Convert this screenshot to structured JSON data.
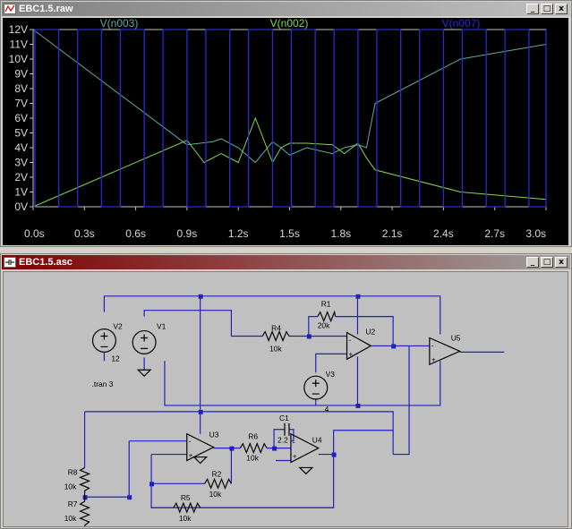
{
  "waveform_window": {
    "title": "EBC1.5.raw",
    "buttons": {
      "minimize": "_",
      "maximize": "□",
      "close": "x"
    }
  },
  "schematic_window": {
    "title": "EBC1.5.asc",
    "buttons": {
      "minimize": "_",
      "maximize": "□",
      "close": "x"
    }
  },
  "chart_data": {
    "type": "line",
    "ylim": [
      0,
      12
    ],
    "xlim": [
      0,
      3.0
    ],
    "grid": false,
    "legend_placement": "top",
    "y_ticks": [
      "0V",
      "1V",
      "2V",
      "3V",
      "4V",
      "5V",
      "6V",
      "7V",
      "8V",
      "9V",
      "10V",
      "11V",
      "12V"
    ],
    "x_ticks": [
      "0.0s",
      "0.3s",
      "0.6s",
      "0.9s",
      "1.2s",
      "1.5s",
      "1.8s",
      "2.1s",
      "2.4s",
      "2.7s",
      "3.0s"
    ],
    "series": [
      {
        "name": "V(n003)",
        "color": "#5fa8a8",
        "x": [
          0,
          0.9,
          1.05,
          1.1,
          1.2,
          1.3,
          1.4,
          1.45,
          1.5,
          1.6,
          1.75,
          1.82,
          1.9,
          1.95,
          2.0,
          2.5,
          3.0
        ],
        "y": [
          12,
          4.2,
          4.4,
          4.6,
          4.0,
          3.0,
          4.4,
          4.0,
          3.5,
          4.0,
          3.6,
          4.0,
          4.2,
          4.0,
          7.0,
          10.0,
          11.0
        ]
      },
      {
        "name": "V(n002)",
        "color": "#7fd84f",
        "x": [
          0,
          0.9,
          1.0,
          1.1,
          1.2,
          1.3,
          1.4,
          1.45,
          1.5,
          1.6,
          1.75,
          1.82,
          1.9,
          1.95,
          2.0,
          2.5,
          3.0
        ],
        "y": [
          0,
          4.5,
          3.0,
          3.6,
          3.0,
          6.0,
          3.0,
          4.0,
          4.3,
          4.3,
          4.2,
          3.6,
          4.3,
          3.3,
          2.5,
          1.0,
          0.5
        ]
      },
      {
        "name": "V(n007)",
        "color": "#2a2ad4",
        "square_wave": {
          "low": 0,
          "high": 12,
          "edges": [
            0.01,
            0.15,
            0.26,
            0.4,
            0.51,
            0.65,
            0.76,
            0.9,
            1.01,
            1.15,
            1.26,
            1.4,
            1.51,
            1.65,
            1.76,
            1.9,
            2.01,
            2.15,
            2.26,
            2.4,
            2.51,
            2.65,
            2.76,
            2.9,
            3.0
          ]
        }
      }
    ]
  },
  "schematic": {
    "labels": {
      "V2": "V2",
      "V1": "V1",
      "V3": "V3",
      "V2_value": "12",
      "V3_value": "4",
      "R4": "R4",
      "R4_value": "10k",
      "R1": "R1",
      "R1_value": "20k",
      "U2": "U2",
      "U5": "U5",
      "U3": "U3",
      "U4": "U4",
      "R6": "R6",
      "R6_value": "10k",
      "C1": "C1",
      "C1_value": "2.2",
      "R2": "R2",
      "R2_value": "10k",
      "R5": "R5",
      "R5_value": "10k",
      "R8": "R8",
      "R8_value": "10k",
      "R7": "R7",
      "R7_value": "10k",
      "directive": ".tran 3"
    },
    "wire_color": "#2020c0",
    "component_color": "#000000"
  }
}
